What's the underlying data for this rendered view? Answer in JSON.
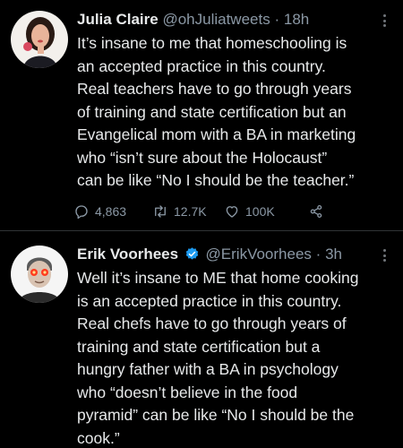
{
  "tweets": [
    {
      "name": "Julia Claire",
      "handle": "@ohJuliatweets",
      "separator": "·",
      "time": "18h",
      "text_lines": [
        "It’s insane to me that homeschooling is",
        "an accepted practice in this country.",
        "Real teachers have to go through years",
        "of training and state certification but an",
        "Evangelical mom with a BA in marketing",
        "who “isn’t sure about the Holocaust”",
        "can be like “No I should be the teacher.”"
      ],
      "replies": "4,863",
      "retweets": "12.7K",
      "likes": "100K",
      "icons": [
        "reply-icon",
        "retweet-icon",
        "like-icon",
        "share-icon",
        "more-icon"
      ]
    },
    {
      "name": "Erik Voorhees",
      "verified": true,
      "handle": "@ErikVoorhees",
      "separator": "·",
      "time": "3h",
      "text_lines": [
        "Well it’s insane to ME that home cooking",
        "is an accepted practice in this country.",
        "Real chefs have to go through years of",
        "training and state certification but a",
        "hungry father with a BA in psychology",
        "who “doesn’t believe in the food",
        "pyramid” can be like “No I should be the",
        "cook.”"
      ],
      "icons": [
        "verified-icon",
        "more-icon"
      ]
    }
  ],
  "colors": {
    "background": "#000000",
    "text": "#e7e9ea",
    "muted": "#8b98a5",
    "verified": "#1d9bf0",
    "divider": "#2f3336"
  }
}
